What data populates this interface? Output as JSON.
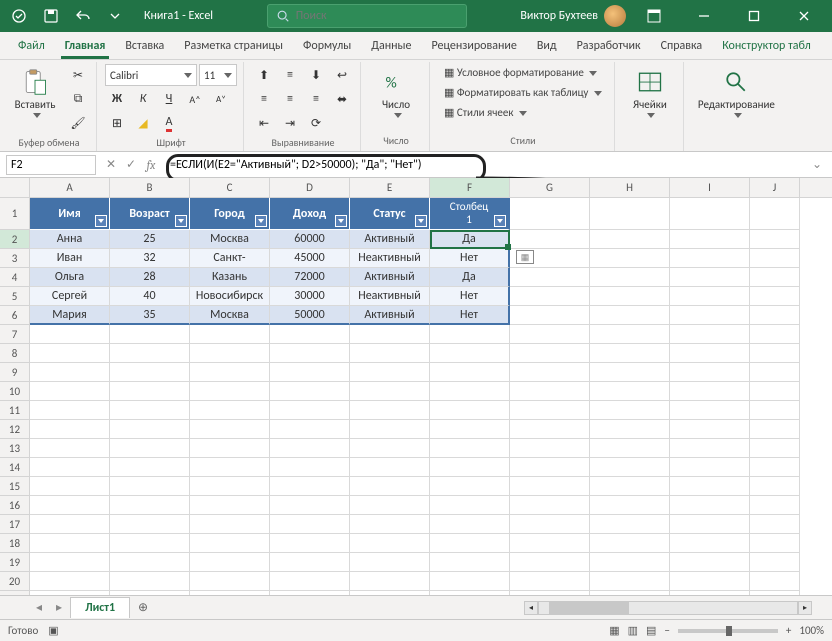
{
  "title": {
    "doc": "Книга1",
    "app": "Excel"
  },
  "search_placeholder": "Поиск",
  "user_name": "Виктор Бухтеев",
  "tabs": {
    "file": "Файл",
    "home": "Главная",
    "insert": "Вставка",
    "layout": "Разметка страницы",
    "formulas": "Формулы",
    "data": "Данные",
    "review": "Рецензирование",
    "view": "Вид",
    "developer": "Разработчик",
    "help": "Справка",
    "design": "Конструктор табл"
  },
  "ribbon": {
    "clipboard": {
      "paste": "Вставить",
      "label": "Буфер обмена"
    },
    "font": {
      "name": "Calibri",
      "size": "11",
      "label": "Шрифт"
    },
    "align": {
      "label": "Выравнивание"
    },
    "number": {
      "btn": "Число",
      "label": "Число"
    },
    "styles": {
      "cond": "Условное форматирование",
      "table": "Форматировать как таблицу",
      "cell": "Стили ячеек",
      "label": "Стили"
    },
    "cells": {
      "btn": "Ячейки"
    },
    "editing": {
      "btn": "Редактирование"
    }
  },
  "namebox": "F2",
  "formula": "=ЕСЛИ(И(E2=\"Активный\"; D2>50000); \"Да\"; \"Нет\")",
  "columns": [
    "A",
    "B",
    "C",
    "D",
    "E",
    "F",
    "G",
    "H",
    "I",
    "J"
  ],
  "headers": {
    "a": "Имя",
    "b": "Возраст",
    "c": "Город",
    "d": "Доход",
    "e": "Статус",
    "f1": "Столбец",
    "f2": "1"
  },
  "rows": [
    {
      "a": "Анна",
      "b": "25",
      "c": "Москва",
      "d": "60000",
      "e": "Активный",
      "f": "Да"
    },
    {
      "a": "Иван",
      "b": "32",
      "c": "Санкт-",
      "d": "45000",
      "e": "Неактивный",
      "f": "Нет"
    },
    {
      "a": "Ольга",
      "b": "28",
      "c": "Казань",
      "d": "72000",
      "e": "Активный",
      "f": "Да"
    },
    {
      "a": "Сергей",
      "b": "40",
      "c": "Новосибирск",
      "d": "30000",
      "e": "Неактивный",
      "f": "Нет"
    },
    {
      "a": "Мария",
      "b": "35",
      "c": "Москва",
      "d": "50000",
      "e": "Активный",
      "f": "Нет"
    }
  ],
  "sheet_tab": "Лист1",
  "status": {
    "ready": "Готово",
    "zoom": "100%"
  }
}
